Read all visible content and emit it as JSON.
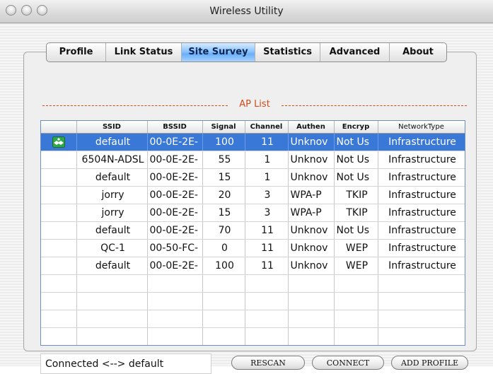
{
  "window": {
    "title": "Wireless Utility"
  },
  "tabs": [
    {
      "label": "Profile",
      "active": false
    },
    {
      "label": "Link Status",
      "active": false
    },
    {
      "label": "Site Survey",
      "active": true
    },
    {
      "label": "Statistics",
      "active": false
    },
    {
      "label": "Advanced",
      "active": false
    },
    {
      "label": "About",
      "active": false
    }
  ],
  "ap_list": {
    "title": "AP List",
    "columns": [
      "",
      "SSID",
      "BSSID",
      "Signal",
      "Channel",
      "Authen",
      "Encryp",
      "NetworkType"
    ],
    "rows": [
      {
        "icon": "connected-handshake-icon",
        "ssid": "default",
        "bssid": "00-0E-2E-",
        "signal": "100",
        "channel": "11",
        "authen": "Unknov",
        "encryp": "Not Us",
        "network_type": "Infrastructure",
        "selected": true
      },
      {
        "icon": "",
        "ssid": "6504N-ADSL",
        "bssid": "00-0E-2E-",
        "signal": "55",
        "channel": "1",
        "authen": "Unknov",
        "encryp": "Not Us",
        "network_type": "Infrastructure",
        "selected": false
      },
      {
        "icon": "",
        "ssid": "default",
        "bssid": "00-0E-2E-",
        "signal": "15",
        "channel": "1",
        "authen": "Unknov",
        "encryp": "Not Us",
        "network_type": "Infrastructure",
        "selected": false
      },
      {
        "icon": "",
        "ssid": "jorry",
        "bssid": "00-0E-2E-",
        "signal": "20",
        "channel": "3",
        "authen": "WPA-P",
        "encryp": "TKIP",
        "network_type": "Infrastructure",
        "selected": false
      },
      {
        "icon": "",
        "ssid": "jorry",
        "bssid": "00-0E-2E-",
        "signal": "15",
        "channel": "3",
        "authen": "WPA-P",
        "encryp": "TKIP",
        "network_type": "Infrastructure",
        "selected": false
      },
      {
        "icon": "",
        "ssid": "default",
        "bssid": "00-0E-2E-",
        "signal": "70",
        "channel": "11",
        "authen": "Unknov",
        "encryp": "Not Us",
        "network_type": "Infrastructure",
        "selected": false
      },
      {
        "icon": "",
        "ssid": "QC-1",
        "bssid": "00-50-FC-",
        "signal": "0",
        "channel": "11",
        "authen": "Unknov",
        "encryp": "WEP",
        "network_type": "Infrastructure",
        "selected": false
      },
      {
        "icon": "",
        "ssid": "default",
        "bssid": "00-0E-2E-",
        "signal": "100",
        "channel": "11",
        "authen": "Unknov",
        "encryp": "WEP",
        "network_type": "Infrastructure",
        "selected": false
      }
    ]
  },
  "status": {
    "text": "Connected <--> default"
  },
  "buttons": {
    "rescan": "RESCAN",
    "connect": "CONNECT",
    "add_profile": "ADD PROFILE"
  },
  "colors": {
    "selection": "#3a78d8",
    "aplist_title": "#d24a1a",
    "active_tab": "#8cc4ff"
  }
}
